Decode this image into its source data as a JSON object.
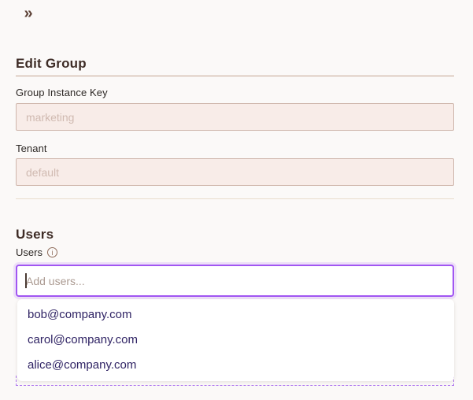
{
  "topbar": {
    "collapse_icon": "»"
  },
  "header": {
    "title": "Edit Group"
  },
  "form": {
    "fields": [
      {
        "label": "Group Instance Key",
        "value": "marketing"
      },
      {
        "label": "Tenant",
        "value": "default"
      }
    ]
  },
  "users": {
    "section_heading": "Users",
    "field_label": "Users",
    "info_icon_glyph": "i",
    "input": {
      "placeholder": "Add users..."
    },
    "options": [
      {
        "email": "bob@company.com"
      },
      {
        "email": "carol@company.com"
      },
      {
        "email": "alice@company.com"
      }
    ]
  },
  "colors": {
    "accent_purple": "#a156f2",
    "dashed_purple": "#ae77ee",
    "option_text": "#2f2364",
    "heading_text": "#3e2c26",
    "label_text": "#2d2825",
    "muted_input_bg": "#f8ece8",
    "muted_input_border": "#cfb6ac",
    "muted_input_text": "#d0bab1",
    "divider_strong": "#c5a593",
    "divider_soft": "#e9dccd",
    "icon_brown": "#5c4136"
  }
}
